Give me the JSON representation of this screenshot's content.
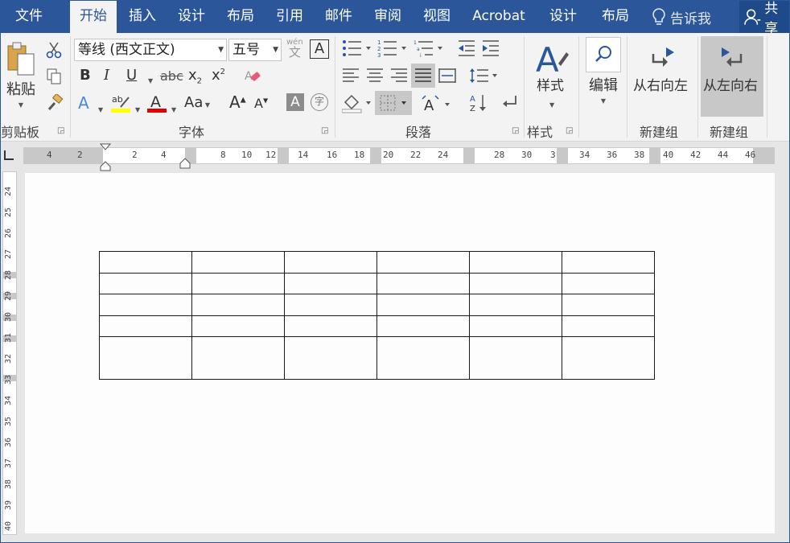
{
  "tabs": [
    "文件",
    "开始",
    "插入",
    "设计",
    "布局",
    "引用",
    "邮件",
    "审阅",
    "视图",
    "Acrobat",
    "设计",
    "布局"
  ],
  "tell_me": "告诉我",
  "share": "共享",
  "clipboard": {
    "paste": "粘贴",
    "group": "剪贴板"
  },
  "font": {
    "name": "等线 (西文正文)",
    "size": "五号",
    "group": "字体",
    "phonetic_top": "wén",
    "phonetic_bottom": "文",
    "bold": "B",
    "italic": "I",
    "underline": "U",
    "strike": "abc",
    "subscript": "x",
    "superscript": "x",
    "change_case": "Aa",
    "grow": "A",
    "shrink": "A",
    "shade": "A",
    "enclose": "字"
  },
  "paragraph": {
    "group": "段落"
  },
  "styles": {
    "label": "样式",
    "group": "样式"
  },
  "editing": {
    "label": "编辑"
  },
  "custom1": {
    "label": "从右向左",
    "group": "新建组"
  },
  "custom2": {
    "label": "从左向右",
    "group": "新建组"
  },
  "ruler_h": [
    "4",
    "2",
    "2",
    "4",
    "8",
    "10",
    "12",
    "14",
    "16",
    "18",
    "20",
    "22",
    "24",
    "28",
    "30",
    "3",
    "34",
    "36",
    "38",
    "40",
    "42",
    "44",
    "46"
  ],
  "ruler_v": [
    "24",
    "25",
    "26",
    "27",
    "28",
    "29",
    "30",
    "31",
    "32",
    "33",
    "34",
    "35",
    "36",
    "37",
    "38",
    "39",
    "40"
  ],
  "table": {
    "rows": 5,
    "cols": 6
  },
  "colors": {
    "accent": "#2b579a",
    "highlight": "#ffff00",
    "font_color": "#e00000"
  }
}
